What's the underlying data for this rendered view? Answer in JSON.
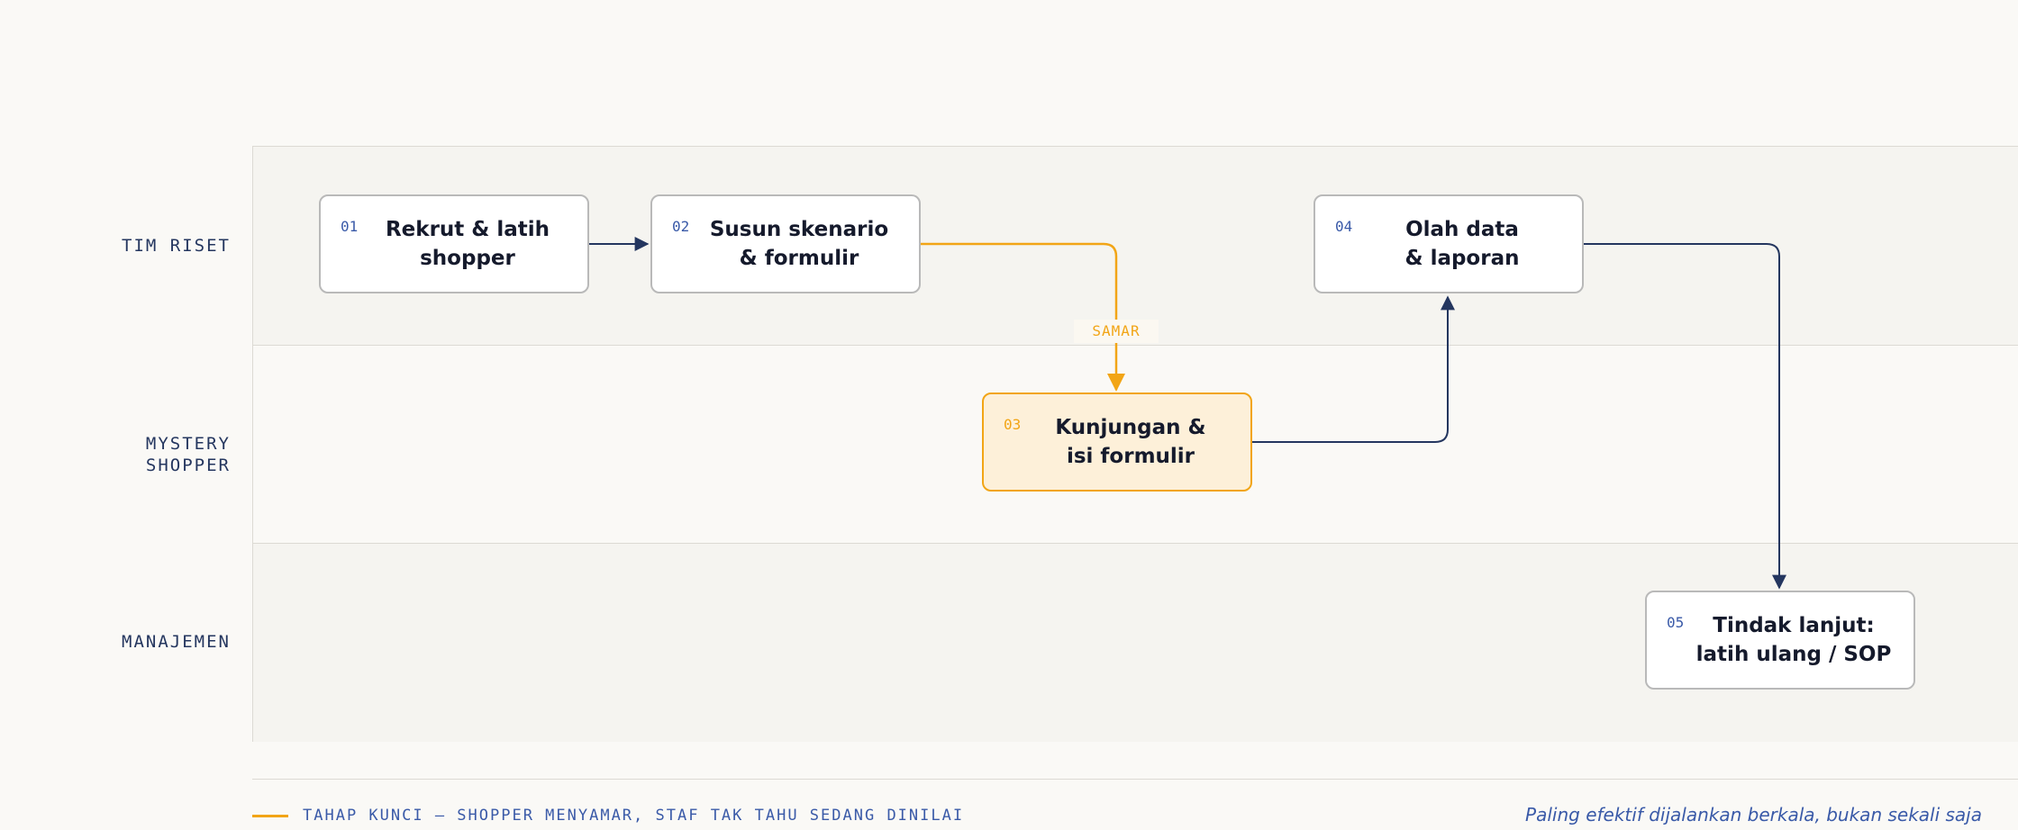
{
  "colors": {
    "accent": "#f2a516",
    "ink": "#24365f",
    "text": "#151a2c",
    "muted": "#3a5aa8"
  },
  "lanes": [
    {
      "label": "TIM RISET"
    },
    {
      "label": "MYSTERY\nSHOPPER"
    },
    {
      "label": "MANAJEMEN"
    }
  ],
  "steps": [
    {
      "num": "01",
      "title": "Rekrut & latih\nshopper"
    },
    {
      "num": "02",
      "title": "Susun skenario\n& formulir"
    },
    {
      "num": "03",
      "title": "Kunjungan &\nisi formulir"
    },
    {
      "num": "04",
      "title": "Olah data\n& laporan"
    },
    {
      "num": "05",
      "title": "Tindak lanjut:\nlatih ulang / SOP"
    }
  ],
  "edge_label": "SAMAR",
  "legend": {
    "text": "TAHAP KUNCI — SHOPPER MENYAMAR, STAF TAK TAHU SEDANG DINILAI"
  },
  "footnote": "Paling efektif dijalankan berkala, bukan sekali saja"
}
